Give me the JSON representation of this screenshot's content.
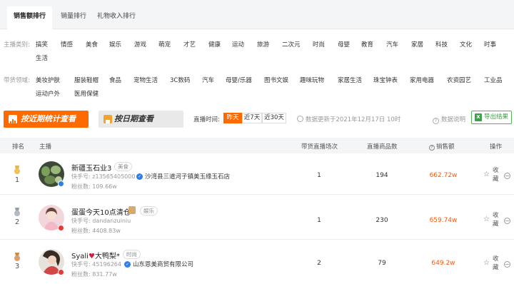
{
  "tabs": [
    {
      "label": "销售额排行",
      "active": true
    },
    {
      "label": "销量排行",
      "active": false
    },
    {
      "label": "礼物收入排行",
      "active": false
    }
  ],
  "filters": {
    "host_label": "主播类别:",
    "host_categories": [
      "搞笑",
      "情感",
      "美食",
      "娱乐",
      "游戏",
      "萌宠",
      "才艺",
      "健康",
      "运动",
      "旅游",
      "二次元",
      "时尚",
      "母婴",
      "教育",
      "汽车",
      "家居",
      "科技",
      "文化",
      "时事",
      "生活"
    ],
    "goods_label": "带货领域:",
    "goods_categories": [
      "美妆护肤",
      "服装鞋帽",
      "食品",
      "宠物生活",
      "3C数码",
      "汽车",
      "母婴/乐器",
      "图书文娱",
      "趣味玩物",
      "家居生活",
      "珠宝钟表",
      "家用电器",
      "农资园艺",
      "工业品",
      "运动户外",
      "医用保健"
    ]
  },
  "toolbar": {
    "recent_btn": "按近期统计查看",
    "daily_btn": "按日期查看",
    "time_label": "直播时间:",
    "time_options": [
      "昨天",
      "近7天",
      "近30天"
    ],
    "time_selected": "昨天",
    "update_text": "数据更新于2021年12月17日 10时",
    "data_note": "数据说明",
    "export_label": "导出结果",
    "colors": {
      "accent": "#ff6a00",
      "export": "#37a03e",
      "sales": "#ff5500"
    }
  },
  "table": {
    "headers": {
      "rank": "排名",
      "host": "主播",
      "sessions": "带货直播场次",
      "goods": "直播商品数",
      "sales": "销售额",
      "action": "操作"
    },
    "rows": [
      {
        "rank": "1",
        "name": "新疆玉石业3",
        "tag": "美食",
        "kuaishou_label": "快手号:",
        "kuaishou_id": "z13565405000",
        "shop": "沙湾县三道河子镇美玉缘玉石店",
        "fans_label": "粉丝数:",
        "fans": "109.66w",
        "sessions": "1",
        "goods": "194",
        "sales": "662.72w",
        "action": "收藏"
      },
      {
        "rank": "2",
        "name": "蛋蛋今天10点清仓",
        "tag": "娱乐",
        "kuaishou_label": "快手号:",
        "kuaishou_id": "dandanzuiniu",
        "shop": "",
        "fans_label": "粉丝数:",
        "fans": "4408.83w",
        "sessions": "1",
        "goods": "230",
        "sales": "659.74w",
        "action": "收藏"
      },
      {
        "rank": "3",
        "name": "Syali",
        "name_suffix": "大鸭梨*",
        "tag": "时尚",
        "kuaishou_label": "快手号:",
        "kuaishou_id": "45196264",
        "shop": "山东恩美商贸有限公司",
        "fans_label": "粉丝数:",
        "fans": "831.77w",
        "sessions": "2",
        "goods": "79",
        "sales": "649.2w",
        "action": "收藏"
      }
    ]
  }
}
